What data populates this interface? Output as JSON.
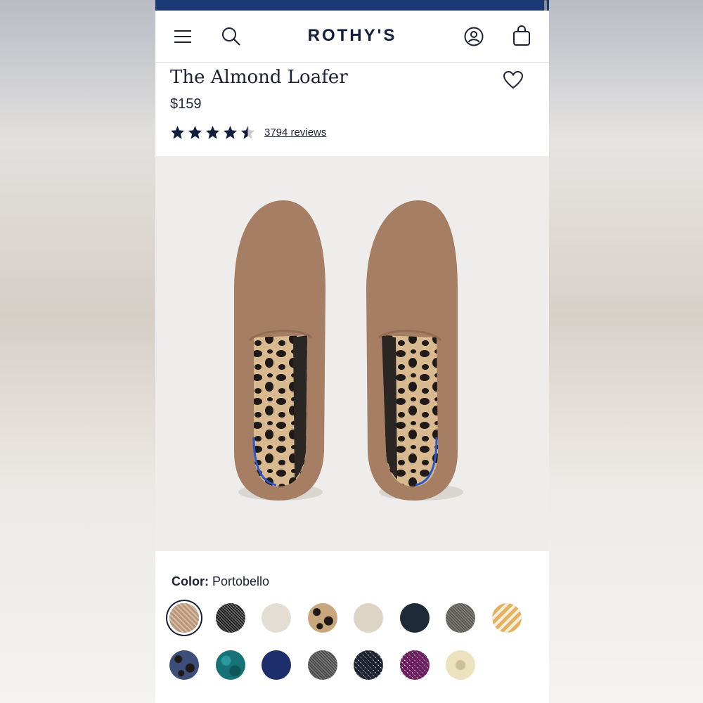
{
  "brand": "ROTHY'S",
  "header": {
    "menu_icon": "hamburger-menu-icon",
    "search_icon": "search-icon",
    "account_icon": "account-icon",
    "bag_icon": "shopping-bag-icon"
  },
  "product": {
    "title": "The Almond Loafer",
    "price": "$159",
    "rating": 4.5,
    "rating_max": 5,
    "reviews_label": "3794 reviews",
    "wishlist_icon": "heart-icon"
  },
  "color": {
    "label": "Color:",
    "selected": "Portobello",
    "swatches": [
      {
        "color": "#b8967a",
        "pattern": "knit"
      },
      {
        "color": "#1e1e1e",
        "pattern": "tweed"
      },
      {
        "color": "#e4ddd3",
        "pattern": "solid"
      },
      {
        "color": "#c9a77c",
        "pattern": "leopard"
      },
      {
        "color": "#ddd5c4",
        "pattern": "solid"
      },
      {
        "color": "#1f2a38",
        "pattern": "solid"
      },
      {
        "color": "#5d5a52",
        "pattern": "tweed"
      },
      {
        "color": "#e3b261",
        "pattern": "stripes"
      },
      {
        "color": "#3b4f7a",
        "pattern": "leopard"
      },
      {
        "color": "#167277",
        "pattern": "mottled"
      },
      {
        "color": "#1c2e6b",
        "pattern": "solid"
      },
      {
        "color": "#4a4a4a",
        "pattern": "tweed"
      },
      {
        "color": "#1e2230",
        "pattern": "diamond"
      },
      {
        "color": "#6b1f5e",
        "pattern": "diamond"
      },
      {
        "color": "#ede2bf",
        "pattern": "floral"
      }
    ]
  },
  "colors": {
    "topbar": "#1b3a75",
    "brand_text": "#0f1f3d",
    "loafer": "#a57e63",
    "hero_bg": "#efedeb"
  }
}
